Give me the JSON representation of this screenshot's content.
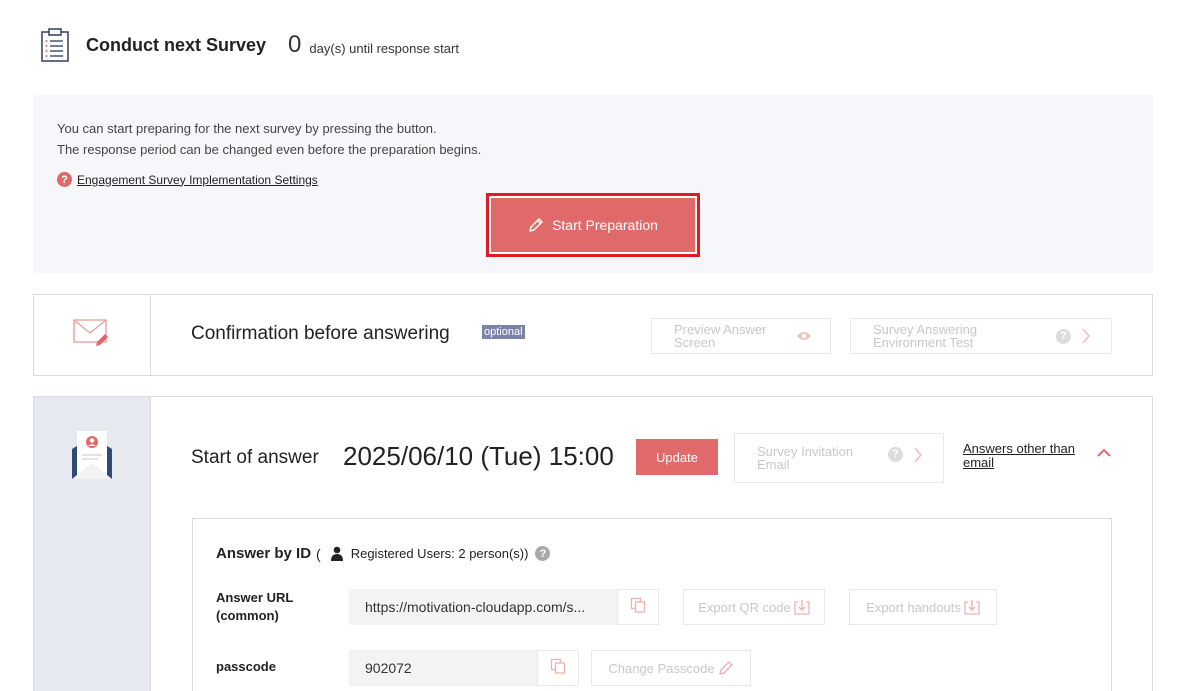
{
  "header": {
    "title": "Conduct next Survey",
    "days_count": "0",
    "days_suffix": "day(s) until response start"
  },
  "prep": {
    "line1": "You can start preparing for the next survey by pressing the button.",
    "line2": "The response period can be changed even before the preparation begins.",
    "settings_link": "Engagement Survey Implementation Settings",
    "start_button": "Start Preparation"
  },
  "confirmation": {
    "title": "Confirmation before answering",
    "optional_badge": "optional",
    "preview_button": "Preview Answer\nScreen",
    "env_test_button": "Survey Answering\nEnvironment Test"
  },
  "answer": {
    "start_label": "Start of answer",
    "start_datetime": "2025/06/10 (Tue) 15:00",
    "update_button": "Update",
    "invitation_button": "Survey Invitation\nEmail",
    "other_link": "Answers other than email",
    "card": {
      "title": "Answer by ID",
      "paren_open": "(",
      "registered_users": "Registered Users: 2 person(s))",
      "url_label": "Answer URL\n(common)",
      "url_value": "https://motivation-cloudapp.com/s...",
      "export_qr": "Export QR code",
      "export_handouts": "Export handouts",
      "passcode_label": "passcode",
      "passcode_value": "902072",
      "change_passcode": "Change Passcode"
    }
  },
  "colors": {
    "accent": "#e06a6a",
    "highlight": "#e01b24",
    "optional_badge": "#7c83a8",
    "panel_bg": "#f6f7fa",
    "side_bg": "#e6e9f0"
  }
}
